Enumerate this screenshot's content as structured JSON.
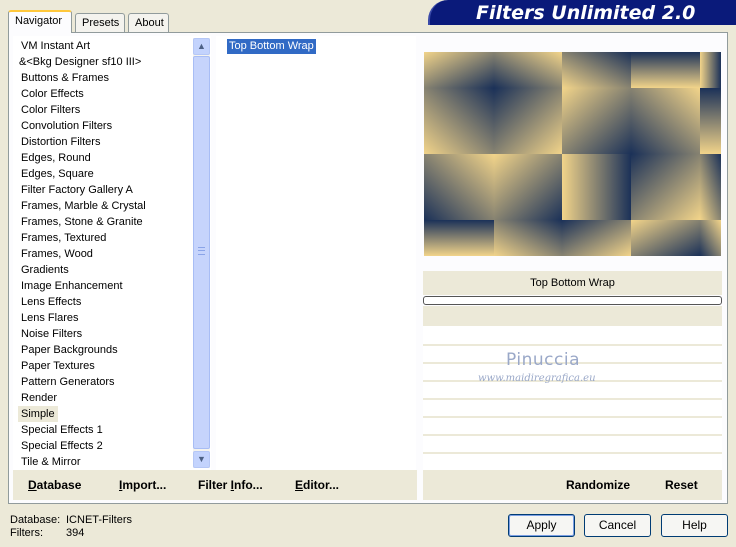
{
  "tabs": [
    {
      "label": "Navigator",
      "active": true
    },
    {
      "label": "Presets",
      "active": false
    },
    {
      "label": "About",
      "active": false
    }
  ],
  "header": {
    "title": "Filters Unlimited 2.0"
  },
  "categories": [
    "VM Instant Art",
    "&<Bkg Designer sf10 III>",
    "Buttons & Frames",
    "Color Effects",
    "Color Filters",
    "Convolution Filters",
    "Distortion Filters",
    "Edges, Round",
    "Edges, Square",
    "Filter Factory Gallery A",
    "Frames, Marble & Crystal",
    "Frames, Stone & Granite",
    "Frames, Textured",
    "Frames, Wood",
    "Gradients",
    "Image Enhancement",
    "Lens Effects",
    "Lens Flares",
    "Noise Filters",
    "Paper Backgrounds",
    "Paper Textures",
    "Pattern Generators",
    "Render",
    "Simple",
    "Special Effects 1",
    "Special Effects 2",
    "Tile & Mirror"
  ],
  "selected_category": "Simple",
  "filters": [
    "Top Bottom Wrap"
  ],
  "selected_filter": "Top Bottom Wrap",
  "preview": {
    "filter_name": "Top Bottom Wrap",
    "colors": [
      "#1b3158",
      "#f2d48a"
    ]
  },
  "watermark": {
    "name": "Pinuccia",
    "url": "www.maidiregrafica.eu"
  },
  "toolbar": {
    "database": {
      "u": "D",
      "rest": "atabase"
    },
    "import": {
      "u": "I",
      "rest": "mport..."
    },
    "filter_info": {
      "pre": "Filter ",
      "u": "I",
      "rest": "nfo..."
    },
    "editor": {
      "u": "E",
      "rest": "ditor..."
    },
    "randomize": "Randomize",
    "reset": "Reset"
  },
  "footer": {
    "database_label": "Database:",
    "database_value": "ICNET-Filters",
    "filters_label": "Filters:",
    "filters_value": "394"
  },
  "buttons": {
    "apply": "Apply",
    "cancel": "Cancel",
    "help": "Help"
  }
}
